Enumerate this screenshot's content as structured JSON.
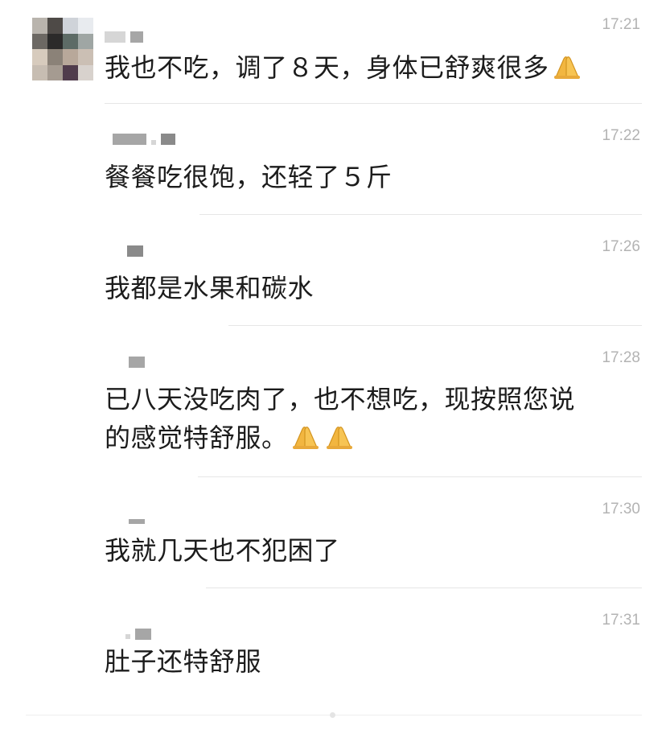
{
  "colors": {
    "background": "#ffffff",
    "text": "#1c1c1c",
    "timestamp": "#b3b3b3",
    "divider": "#e6e6e6",
    "emoji": "#f2b640"
  },
  "messages": [
    {
      "time": "17:21",
      "text": "我也不吃，调了８天，身体已舒爽很多",
      "emoji": [
        "folded-hands-icon"
      ]
    },
    {
      "time": "17:22",
      "text": "餐餐吃很饱，还轻了５斤"
    },
    {
      "time": "17:26",
      "text": "我都是水果和碳水"
    },
    {
      "time": "17:28",
      "text_line1": "已八天没吃肉了，也不想吃，现按照您说",
      "text_line2": "的感觉特舒服。",
      "emoji": [
        "folded-hands-icon",
        "folded-hands-icon"
      ]
    },
    {
      "time": "17:30",
      "text": "我就几天也不犯困了"
    },
    {
      "time": "17:31",
      "text": "肚子还特舒服"
    }
  ]
}
